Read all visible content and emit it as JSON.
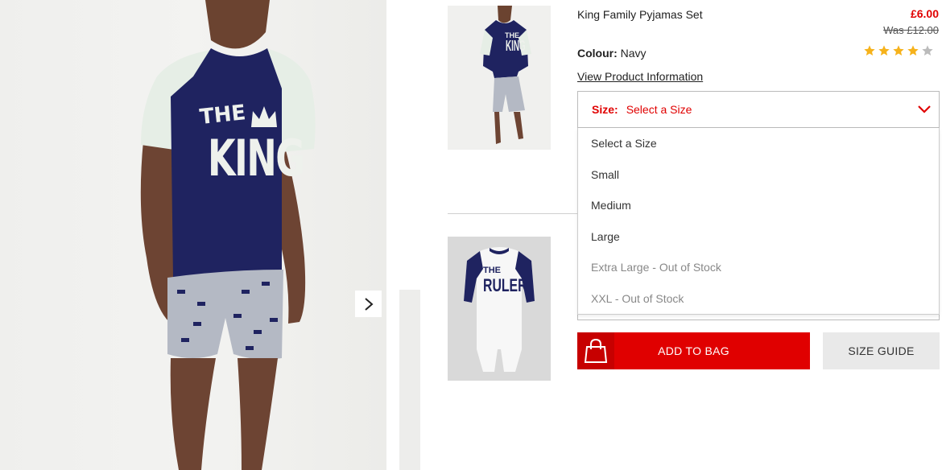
{
  "product": {
    "name": "King Family Pyjamas Set",
    "price": "£6.00",
    "was_price": "Was £12.00",
    "colour_label": "Colour:",
    "colour_value": "Navy",
    "rating": 4,
    "rating_max": 5,
    "view_info_link": "View Product Information"
  },
  "size": {
    "label": "Size:",
    "selected": "Select a Size",
    "options": [
      {
        "label": "Select a Size",
        "available": true
      },
      {
        "label": "Small",
        "available": true
      },
      {
        "label": "Medium",
        "available": true
      },
      {
        "label": "Large",
        "available": true
      },
      {
        "label": "Extra Large - Out of Stock",
        "available": false
      },
      {
        "label": "XXL - Out of Stock",
        "available": false
      }
    ]
  },
  "buttons": {
    "add_to_bag": "ADD TO BAG",
    "size_guide": "SIZE GUIDE"
  },
  "images": {
    "main_shirt_text_top": "THE",
    "main_shirt_text_bottom": "KING",
    "thumb2_text_top": "THE",
    "thumb2_text_bottom": "RULER"
  },
  "colors": {
    "accent_red": "#e00000",
    "navy": "#1f2360",
    "star_gold": "#f6b21b",
    "star_grey": "#bbbbbb"
  },
  "icons": {
    "next": "chevron-right-icon",
    "dropdown": "chevron-down-icon",
    "bag": "shopping-bag-icon",
    "star": "star-icon"
  }
}
